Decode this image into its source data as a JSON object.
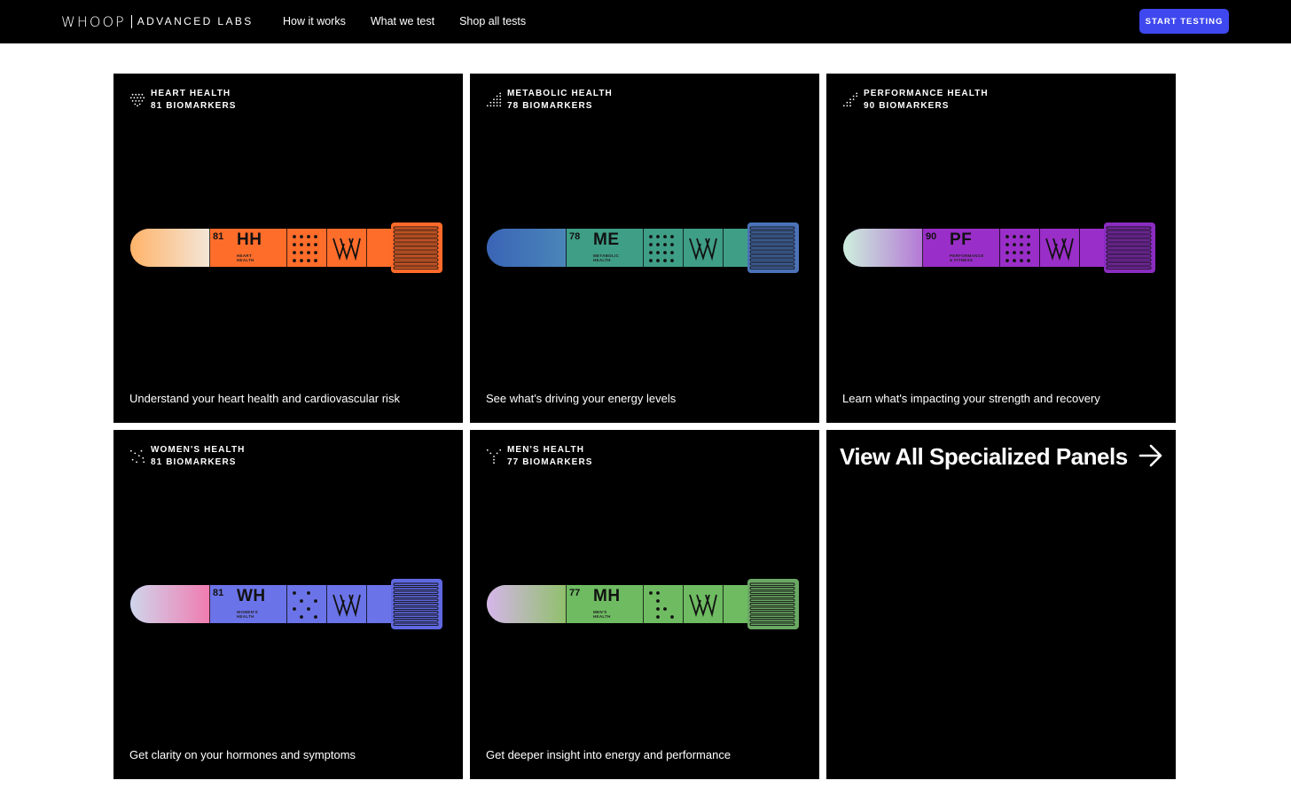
{
  "nav": {
    "logo": {
      "wordmark": "WHOOP",
      "sub": "ADVANCED LABS"
    },
    "links": [
      {
        "label": "How it works"
      },
      {
        "label": "What we test"
      },
      {
        "label": "Shop all tests"
      }
    ],
    "cta_label": "START TESTING",
    "cta_color": "#3f48ee"
  },
  "panels": [
    {
      "title": "HEART HEALTH",
      "biomarkers": "81 BIOMARKERS",
      "description": "Understand your heart health and cardiovascular risk",
      "tube": {
        "number": "81",
        "code": "HH",
        "sub_line1": "HEART",
        "sub_line2": "HEALTH"
      },
      "colors": {
        "main": "#ff6d2b",
        "tip_start": "#ffb36a",
        "tip_end": "#f3e6d8",
        "cap": "#ff6a2a"
      },
      "icon": "heart-dots-icon"
    },
    {
      "title": "METABOLIC HEALTH",
      "biomarkers": "78 BIOMARKERS",
      "description": "See what's driving your energy levels",
      "tube": {
        "number": "78",
        "code": "ME",
        "sub_line1": "METABOLIC",
        "sub_line2": "HEALTH"
      },
      "colors": {
        "main": "#3f9e86",
        "tip_start": "#3a64b6",
        "tip_end": "#4a86b8",
        "cap": "#4b72b8"
      },
      "icon": "bars-dots-icon"
    },
    {
      "title": "PERFORMANCE HEALTH",
      "biomarkers": "90 BIOMARKERS",
      "description": "Learn what's impacting your strength and recovery",
      "tube": {
        "number": "90",
        "code": "PF",
        "sub_line1": "PERFORMANCE",
        "sub_line2": "& FITNESS"
      },
      "colors": {
        "main": "#9a2ec8",
        "tip_start": "#cdf0dc",
        "tip_end": "#b477d6",
        "cap": "#8a2cc0"
      },
      "icon": "stairs-dots-icon"
    },
    {
      "title": "WOMEN'S HEALTH",
      "biomarkers": "81 BIOMARKERS",
      "description": "Get clarity on your hormones and symptoms",
      "tube": {
        "number": "81",
        "code": "WH",
        "sub_line1": "WOMEN'S",
        "sub_line2": "HEALTH"
      },
      "colors": {
        "main": "#6b73e8",
        "tip_start": "#cfd6ec",
        "tip_end": "#f07bb0",
        "cap": "#5f68e0"
      },
      "icon": "scatter-dots-icon"
    },
    {
      "title": "MEN'S HEALTH",
      "biomarkers": "77 BIOMARKERS",
      "description": "Get deeper insight into energy and performance",
      "tube": {
        "number": "77",
        "code": "MH",
        "sub_line1": "MEN'S",
        "sub_line2": "HEALTH"
      },
      "colors": {
        "main": "#6fbb62",
        "tip_start": "#d6b6ea",
        "tip_end": "#8fc06a",
        "cap": "#6aa864"
      },
      "icon": "y-dots-icon"
    }
  ],
  "view_all": {
    "label": "View All Specialized Panels",
    "icon": "arrow-right-icon"
  }
}
